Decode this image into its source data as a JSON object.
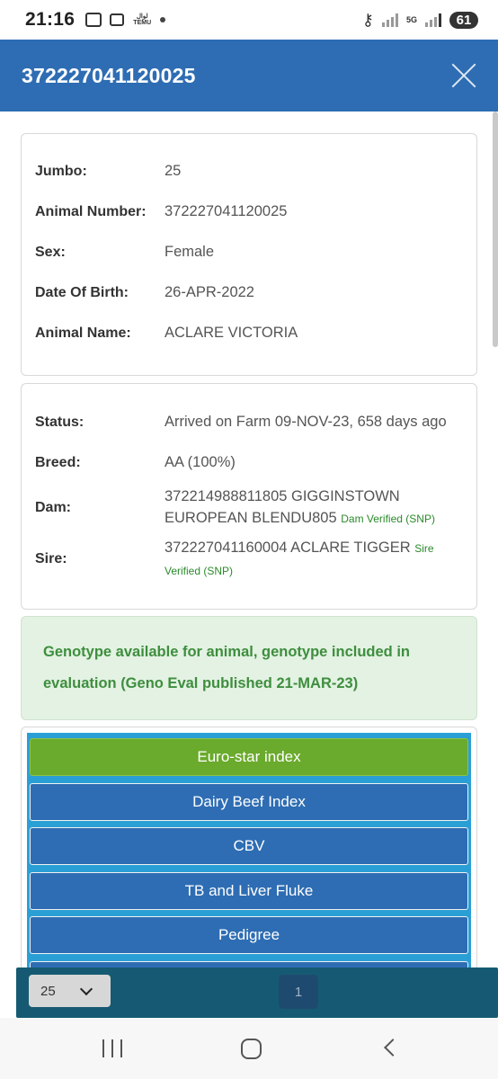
{
  "status_bar": {
    "time": "21:16",
    "temu_label": "لوال TEMU",
    "fiveg_label": "5G",
    "battery": "61"
  },
  "header": {
    "title": "372227041120025"
  },
  "animal_info": {
    "rows": [
      {
        "label": "Jumbo:",
        "value": "25"
      },
      {
        "label": "Animal Number:",
        "value": "372227041120025"
      },
      {
        "label": "Sex:",
        "value": "Female"
      },
      {
        "label": "Date Of Birth:",
        "value": "26-APR-2022"
      },
      {
        "label": "Animal Name:",
        "value": "ACLARE VICTORIA"
      }
    ]
  },
  "status_info": {
    "status_label": "Status:",
    "status_value": "Arrived on Farm 09-NOV-23, 658 days ago",
    "breed_label": "Breed:",
    "breed_value": "AA (100%)",
    "dam_label": "Dam:",
    "dam_value": "372214988811805 GIGGINSTOWN EUROPEAN BLENDU805",
    "dam_verified": "Dam Verified (SNP)",
    "sire_label": "Sire:",
    "sire_value": "372227041160004 ACLARE TIGGER",
    "sire_verified": "Sire Verified (SNP)"
  },
  "genotype_notice": "Genotype available for animal, genotype included in evaluation (Geno Eval published 21-MAR-23)",
  "menu": {
    "items": [
      {
        "label": "Euro-star index",
        "active": true
      },
      {
        "label": "Dairy Beef Index",
        "active": false
      },
      {
        "label": "CBV",
        "active": false
      },
      {
        "label": "TB and Liver Fluke",
        "active": false
      },
      {
        "label": "Pedigree",
        "active": false
      }
    ]
  },
  "pager": {
    "page_size": "25",
    "current_page": "1"
  },
  "colors": {
    "header": "#2e6db3",
    "menu_active": "#6aaa2c",
    "menu_button": "#2e6db3",
    "genotype_text": "#3e8e3e"
  }
}
